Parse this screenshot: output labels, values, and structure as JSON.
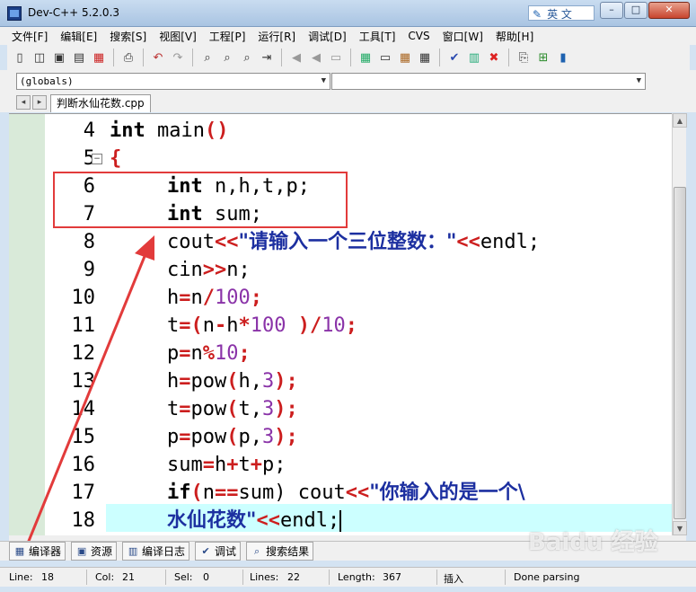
{
  "window": {
    "title": "Dev-C++ 5.2.0.3",
    "ime_label": "英 文",
    "min_glyph": "–",
    "max_glyph": "□",
    "close_glyph": "✕"
  },
  "menu": {
    "items": [
      "文件[F]",
      "编辑[E]",
      "搜索[S]",
      "视图[V]",
      "工程[P]",
      "运行[R]",
      "调试[D]",
      "工具[T]",
      "CVS",
      "窗口[W]",
      "帮助[H]"
    ]
  },
  "toolbar": {
    "icons": [
      "new-file-icon",
      "open-icon",
      "save-icon",
      "save-all-icon",
      "close-file-icon",
      "print-icon",
      "undo-icon",
      "redo-icon",
      "find-icon",
      "replace-icon",
      "find-next-icon",
      "goto-line-icon",
      "indent-icon",
      "unindent-icon",
      "toggle-comment-icon",
      "new-project-icon",
      "class-browser-icon",
      "layout-icon",
      "window-icon",
      "check-icon",
      "chart-icon",
      "delete-icon",
      "compile-icon",
      "run-icon",
      "debug-icon"
    ]
  },
  "combos": {
    "scope": "(globals)",
    "symbol": "",
    "dropdown_glyph": "▼"
  },
  "tabs": {
    "prev_glyph": "◂",
    "next_glyph": "▸",
    "active_file": "判断水仙花数.cpp"
  },
  "editor": {
    "line_numbers": [
      "4",
      "5",
      "6",
      "7",
      "8",
      "9",
      "10",
      "11",
      "12",
      "13",
      "14",
      "15",
      "16",
      "17",
      "18"
    ],
    "fold_glyph": "⊟"
  },
  "code": {
    "l4_kw": "int",
    "l4_rest": " main",
    "l4_paren": "()",
    "l5_brace": "{",
    "l6_kw": "int",
    "l6_rest": " n,h,t,p;",
    "l7_kw": "int",
    "l7_rest": " sum;",
    "l8_a": "cout",
    "l8_op": "<<",
    "l8_str": "\"请输入一个三位整数：\"",
    "l8_op2": "<<",
    "l8_end": "endl;",
    "l9_a": "cin",
    "l9_op": ">>",
    "l9_end": "n;",
    "l10_a": "h",
    "l10_op": "=",
    "l10_b": "n",
    "l10_op2": "/",
    "l10_num": "100",
    "l10_end": ";",
    "l11_a": "t",
    "l11_op": "=(",
    "l11_b": "n",
    "l11_op2": "-",
    "l11_c": "h",
    "l11_op3": "*",
    "l11_num": "100",
    "l11_op4": " )/",
    "l11_num2": "10",
    "l11_end": ";",
    "l12_a": "p",
    "l12_op": "=",
    "l12_b": "n",
    "l12_op2": "%",
    "l12_num": "10",
    "l12_end": ";",
    "l13_a": "h",
    "l13_op": "=",
    "l13_b": "pow",
    "l13_op2": "(",
    "l13_c": "h,",
    "l13_num": "3",
    "l13_end": ");",
    "l14_a": "t",
    "l14_op": "=",
    "l14_b": "pow",
    "l14_op2": "(",
    "l14_c": "t,",
    "l14_num": "3",
    "l14_end": ");",
    "l15_a": "p",
    "l15_op": "=",
    "l15_b": "pow",
    "l15_op2": "(",
    "l15_c": "p,",
    "l15_num": "3",
    "l15_end": ");",
    "l16_a": "sum",
    "l16_op": "=",
    "l16_b": "h",
    "l16_op2": "+",
    "l16_c": "t",
    "l16_op3": "+",
    "l16_d": "p;",
    "l17_kw": "if",
    "l17_op": "(",
    "l17_a": "n",
    "l17_op2": "==",
    "l17_b": "sum)",
    "l17_c": " cout",
    "l17_op3": "<<",
    "l17_str": "\"你输入的是一个\\",
    "l18_str": "水仙花数\"",
    "l18_op": "<<",
    "l18_end": "endl;"
  },
  "bottom_tabs": [
    "编译器",
    "资源",
    "编译日志",
    "调试",
    "搜索结果"
  ],
  "status": {
    "line_label": "Line:",
    "line_value": "18",
    "col_label": "Col:",
    "col_value": "21",
    "sel_label": "Sel:",
    "sel_value": "0",
    "lines_label": "Lines:",
    "lines_value": "22",
    "length_label": "Length:",
    "length_value": "367",
    "mode": "插入",
    "parse_status": "Done parsing"
  },
  "watermark": "Baidu 经验",
  "colors": {
    "annotation_red": "#e23b3b",
    "active_line": "#ccffff",
    "operator": "#cc1e1e",
    "number": "#8a33a8",
    "string": "#1c2fa0"
  }
}
